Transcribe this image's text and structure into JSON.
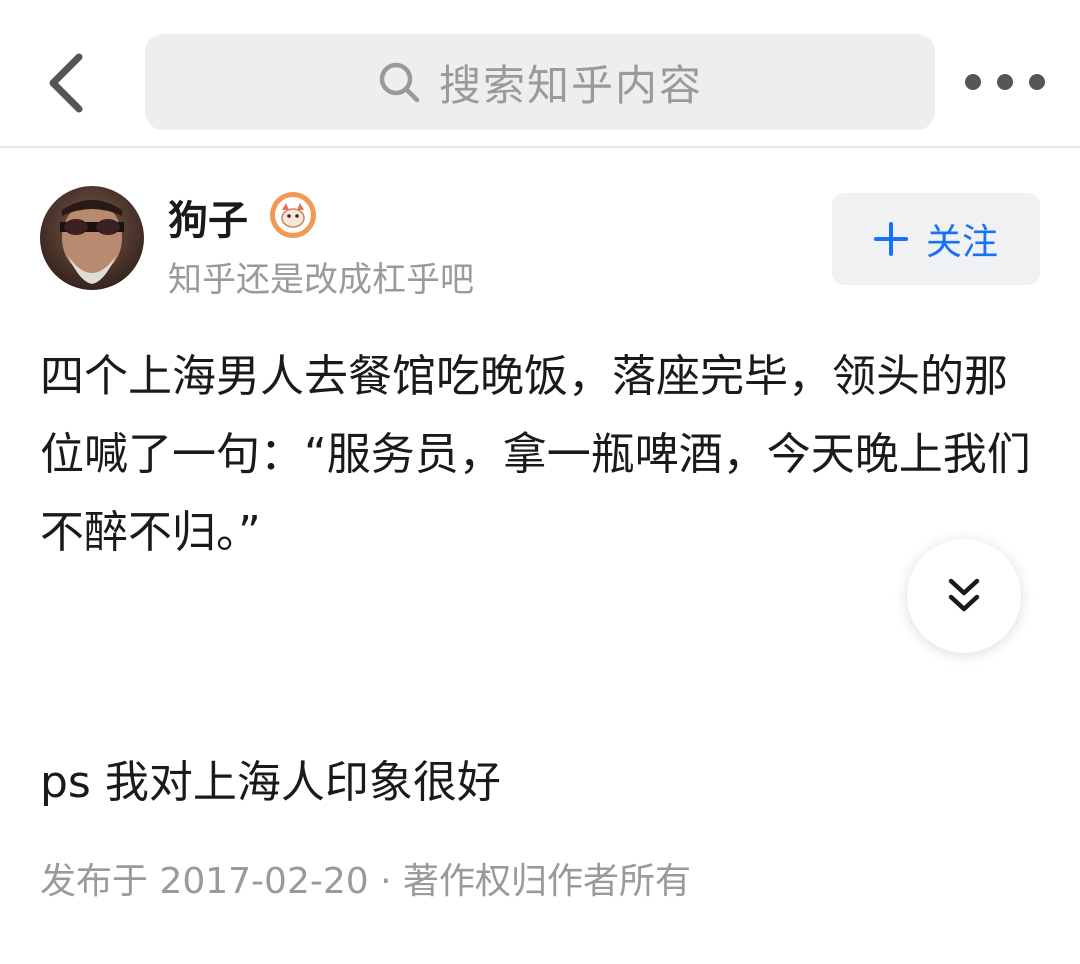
{
  "header": {
    "search_placeholder": "搜索知乎内容"
  },
  "author": {
    "name": "狗子",
    "bio": "知乎还是改成杠乎吧"
  },
  "follow_label": "关注",
  "content": {
    "paragraph": "四个上海男人去餐馆吃晚饭，落座完毕，领头的那位喊了一句：“服务员，拿一瓶啤酒，今天晚上我们不醉不归。”",
    "ps": "ps 我对上海人印象很好"
  },
  "meta": "发布于 2017-02-20 · 著作权归作者所有",
  "colors": {
    "accent": "#1772f6",
    "muted": "#9a9a9e",
    "text": "#1a1a1a",
    "search_bg": "#eeeeef"
  }
}
